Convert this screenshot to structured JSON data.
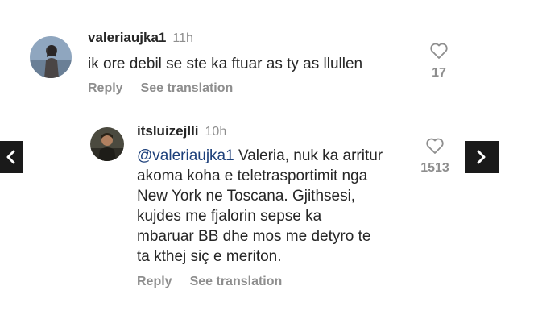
{
  "comments": [
    {
      "username": "valeriaujka1",
      "time": "11h",
      "text": "ik ore debil se ste ka ftuar as ty as llullen",
      "reply_label": "Reply",
      "translate_label": "See translation",
      "likes": "17",
      "avatar_icon": "user-photo-avatar"
    },
    {
      "username": "itsluizejlli",
      "time": "10h",
      "mention": "@valeriaujka1",
      "text_lines": [
        " Valeria, nuk ka arritur",
        "akoma koha e teletrasportimit nga",
        "New York ne Toscana. Gjithsesi,",
        "kujdes me fjalorin sepse ka",
        "mbaruar BB dhe mos me detyro te",
        "ta kthej siç e meriton."
      ],
      "reply_label": "Reply",
      "translate_label": "See translation",
      "likes": "1513",
      "avatar_icon": "user-photo-avatar"
    }
  ],
  "nav": {
    "prev_icon": "chevron-left-icon",
    "next_icon": "chevron-right-icon"
  },
  "colors": {
    "text": "#262626",
    "muted": "#8e8e8e",
    "mention": "#1c3f7a",
    "nav_bg": "#1a1a1a"
  }
}
